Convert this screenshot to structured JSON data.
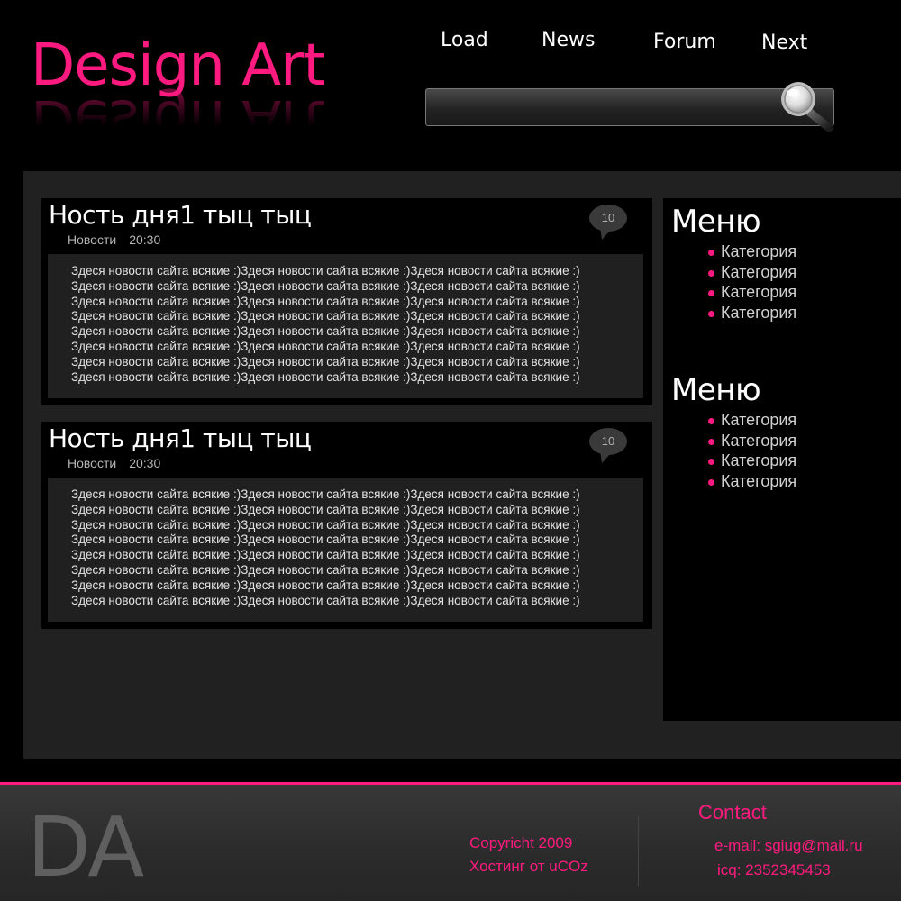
{
  "header": {
    "logo": "Design Art",
    "nav": [
      "Load",
      "News",
      "Forum",
      "Next"
    ],
    "search": {
      "placeholder": "",
      "value": ""
    }
  },
  "posts": [
    {
      "title": "Ность дня1 тыц тыц",
      "category": "Новости",
      "time": "20:30",
      "comments": "10",
      "lines": [
        "Здеся новости сайта всякие :)Здеся новости сайта всякие :)Здеся новости сайта всякие :)",
        "Здеся новости сайта всякие :)Здеся новости сайта всякие :)Здеся новости сайта всякие :)",
        "Здеся новости сайта всякие :)Здеся новости сайта всякие :)Здеся новости сайта всякие :)",
        "Здеся новости сайта всякие :)Здеся новости сайта всякие :)Здеся новости сайта всякие :)",
        "Здеся новости сайта всякие :)Здеся новости сайта всякие :)Здеся новости сайта всякие :)",
        "Здеся новости сайта всякие :)Здеся новости сайта всякие :)Здеся новости сайта всякие :)",
        "Здеся новости сайта всякие :)Здеся новости сайта всякие :)Здеся новости сайта всякие :)",
        "Здеся новости сайта всякие :)Здеся новости сайта всякие :)Здеся новости сайта всякие :)"
      ]
    },
    {
      "title": "Ность дня1 тыц тыц",
      "category": "Новости",
      "time": "20:30",
      "comments": "10",
      "lines": [
        "Здеся новости сайта всякие :)Здеся новости сайта всякие :)Здеся новости сайта всякие :)",
        "Здеся новости сайта всякие :)Здеся новости сайта всякие :)Здеся новости сайта всякие :)",
        "Здеся новости сайта всякие :)Здеся новости сайта всякие :)Здеся новости сайта всякие :)",
        "Здеся новости сайта всякие :)Здеся новости сайта всякие :)Здеся новости сайта всякие :)",
        "Здеся новости сайта всякие :)Здеся новости сайта всякие :)Здеся новости сайта всякие :)",
        "Здеся новости сайта всякие :)Здеся новости сайта всякие :)Здеся новости сайта всякие :)",
        "Здеся новости сайта всякие :)Здеся новости сайта всякие :)Здеся новости сайта всякие :)",
        "Здеся новости сайта всякие :)Здеся новости сайта всякие :)Здеся новости сайта всякие :)"
      ]
    }
  ],
  "sidebar": {
    "menus": [
      {
        "title": "Меню",
        "items": [
          "Категория",
          "Категория",
          "Категория",
          "Категория"
        ]
      },
      {
        "title": "Меню",
        "items": [
          "Категория",
          "Категория",
          "Категория",
          "Категория"
        ]
      }
    ]
  },
  "footer": {
    "logo": "DA",
    "copyright": "Copyricht 2009",
    "hosting": "Хостинг от uCOz",
    "contact_title": "Contact",
    "email": "e-mail: sgiug@mail.ru",
    "icq": "icq: 2352345453"
  },
  "colors": {
    "accent": "#ff1a80",
    "background": "#000000",
    "panel": "#212121"
  },
  "icons": {
    "search": "magnifier-icon",
    "comments": "speech-bubble-icon",
    "bullet": "pink-dot-icon"
  }
}
